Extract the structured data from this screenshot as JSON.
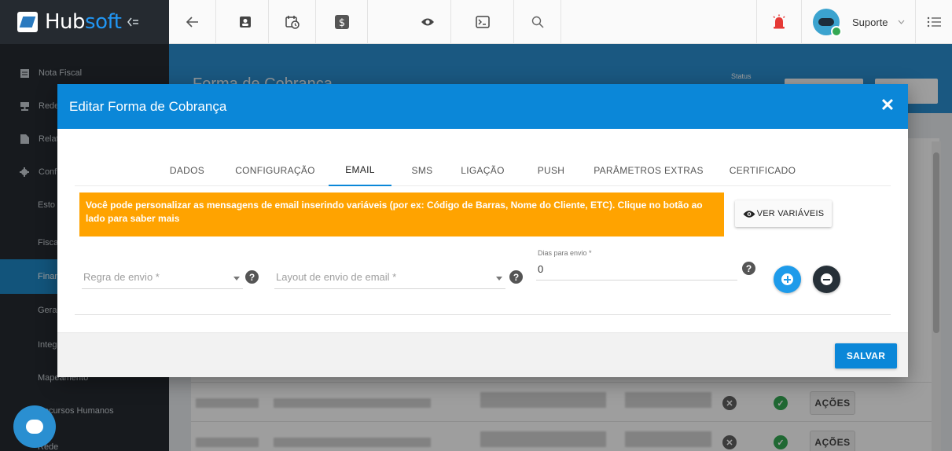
{
  "app": {
    "logo_text_primary": "Hub",
    "logo_text_accent": "soft",
    "user_name": "Suporte"
  },
  "sidebar": {
    "items": [
      {
        "label": "Nota Fiscal"
      },
      {
        "label": "Rede"
      },
      {
        "label": "Relat"
      },
      {
        "label": "Conf"
      },
      {
        "label": "Esto"
      },
      {
        "label": "Fisca"
      },
      {
        "label": "Finan"
      },
      {
        "label": "Gera"
      },
      {
        "label": "Integ"
      },
      {
        "label": "Mapeamento"
      },
      {
        "label": "Recursos Humanos"
      },
      {
        "label": "Rede"
      }
    ]
  },
  "page": {
    "title": "Forma de Cobrança",
    "status_label": "Status",
    "actions_label": "AÇÕES"
  },
  "modal": {
    "title": "Editar Forma de Cobrança",
    "close": "✕",
    "tabs": [
      {
        "label": "DADOS"
      },
      {
        "label": "CONFIGURAÇÃO"
      },
      {
        "label": "EMAIL"
      },
      {
        "label": "SMS"
      },
      {
        "label": "LIGAÇÃO"
      },
      {
        "label": "PUSH"
      },
      {
        "label": "PARÂMETROS EXTRAS"
      },
      {
        "label": "CERTIFICADO"
      }
    ],
    "active_tab": "EMAIL",
    "alert_text": "Você pode personalizar as mensagens de email inserindo variáveis (por ex: Código de Barras, Nome do Cliente, ETC). Clique no botão ao lado para saber mais",
    "ver_variaveis_label": "VER VARIÁVEIS",
    "fields": {
      "regra_placeholder": "Regra de envio *",
      "layout_placeholder": "Layout de envio de email *",
      "dias_label": "Dias para envio *",
      "dias_value": "0"
    },
    "help_symbol": "?",
    "save_label": "SALVAR"
  },
  "colors": {
    "primary": "#0b87d8",
    "alert": "#ffa300",
    "sidebar": "#262b31",
    "success": "#34a853"
  }
}
